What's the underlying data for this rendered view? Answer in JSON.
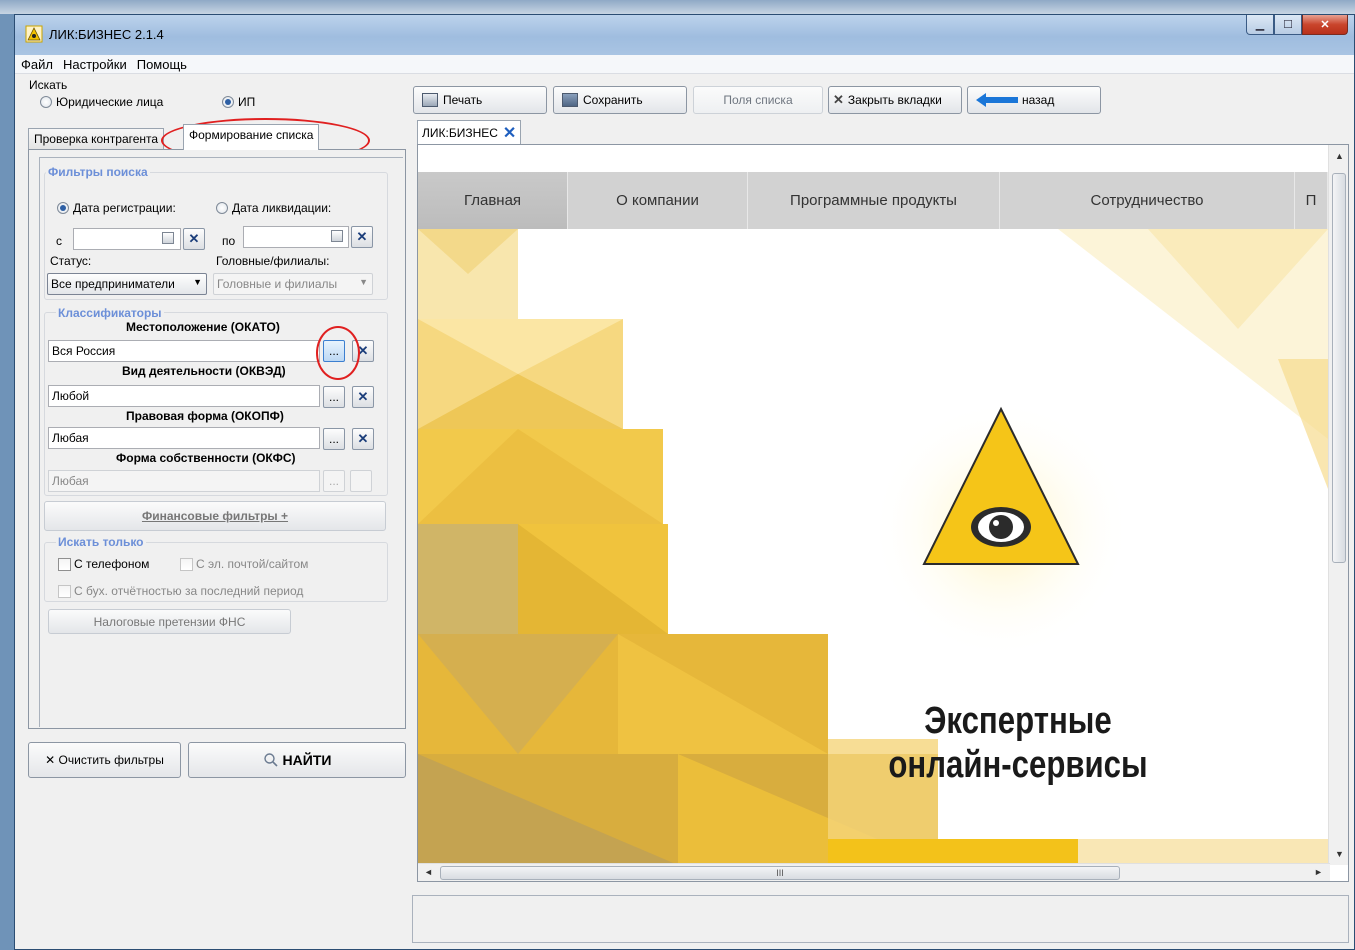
{
  "window": {
    "title": "ЛИК:БИЗНЕС 2.1.4",
    "controls": [
      "minimize",
      "maximize",
      "close"
    ]
  },
  "menu": [
    "Файл",
    "Настройки",
    "Помощь"
  ],
  "search": {
    "legend": "Искать",
    "options": [
      "Юридические лица",
      "ИП"
    ],
    "selected": "ИП"
  },
  "tabs": {
    "check": "Проверка контрагента",
    "build": "Формирование списка",
    "active": "Формирование списка"
  },
  "filters": {
    "legend": "Фильтры поиска",
    "date_reg": "Дата регистрации:",
    "date_liq": "Дата ликвидации:",
    "date_selected": "Дата регистрации:",
    "from_label": "с",
    "to_label": "по",
    "from_value": "",
    "to_value": "",
    "status_label": "Статус:",
    "status_value": "Все предприниматели",
    "branches_label": "Головные/филиалы:",
    "branches_value": "Головные и филиалы"
  },
  "classifiers": {
    "legend": "Классификаторы",
    "okato_label": "Местоположение (ОКАТО)",
    "okato_value": "Вся Россия",
    "okved_label": "Вид деятельности (ОКВЭД)",
    "okved_value": "Любой",
    "okopf_label": "Правовая форма (ОКОПФ)",
    "okopf_value": "Любая",
    "okfs_label": "Форма собственности (ОКФС)",
    "okfs_value": "Любая",
    "browse_glyph": "...",
    "clear_glyph": "✕"
  },
  "financial_filters": "Финансовые фильтры +",
  "only": {
    "legend": "Искать только",
    "phone": "С телефоном",
    "email": "С эл. почтой/сайтом",
    "reports": "С бух. отчётностью за последний период"
  },
  "tax_claims_button": "Налоговые претензии ФНС",
  "clear_filters_button": "✕ Очистить фильтры",
  "find_button": "НАЙТИ",
  "toolbar": {
    "print": "Печать",
    "save": "Сохранить",
    "fields": "Поля списка",
    "close_tabs": "Закрыть вкладки",
    "back": "назад"
  },
  "doc_tab": {
    "label": "ЛИК:БИЗНЕС",
    "close": "✕"
  },
  "site_nav": [
    "Главная",
    "О компании",
    "Программные продукты",
    "Сотрудничество",
    "П"
  ],
  "hero": {
    "line1": "Экспертные",
    "line2": "онлайн-сервисы"
  },
  "scrollbar_grip": "III",
  "colors": {
    "accent_yellow": "#f5c518",
    "legend_blue": "#6c8fd8",
    "annotation_red": "#e02020"
  }
}
